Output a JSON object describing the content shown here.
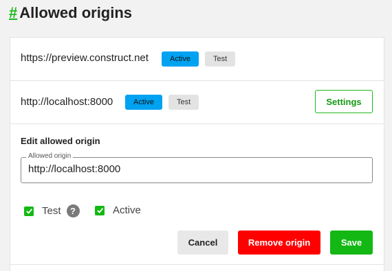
{
  "header": {
    "hash": "#",
    "title": "Allowed origins"
  },
  "origins": [
    {
      "url": "https://preview.construct.net",
      "badges": [
        "Active",
        "Test"
      ]
    },
    {
      "url": "http://localhost:8000",
      "badges": [
        "Active",
        "Test"
      ],
      "settings_label": "Settings"
    }
  ],
  "edit": {
    "heading": "Edit allowed origin",
    "field_legend": "Allowed origin",
    "field_value": "http://localhost:8000",
    "test_label": "Test",
    "test_checked": true,
    "help_icon": "?",
    "active_label": "Active",
    "active_checked": true
  },
  "actions": {
    "cancel": "Cancel",
    "remove": "Remove origin",
    "save": "Save"
  },
  "colors": {
    "accent": "#14b814",
    "active_badge": "#00a2f2",
    "danger": "#ff0000"
  }
}
